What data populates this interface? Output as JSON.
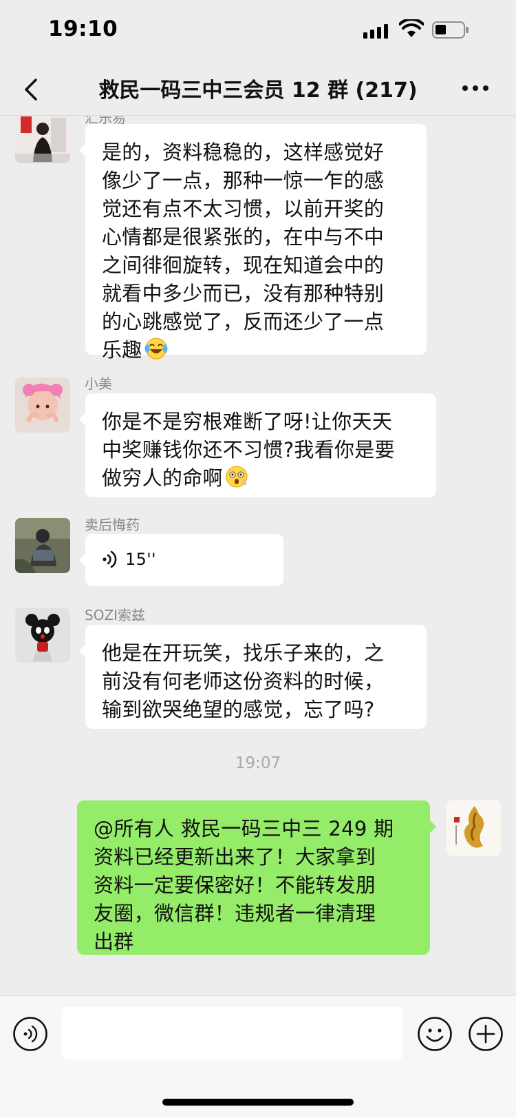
{
  "status_bar": {
    "time": "19:10"
  },
  "nav": {
    "title": "救民一码三中三会员 12 群 (217)"
  },
  "messages": [
    {
      "sender": "汇乐易",
      "lines": [
        "是的，资料稳稳的，这样感觉好",
        "像少了一点，那种一惊一乍的感",
        "觉还有点不太习惯，以前开奖的",
        "心情都是很紧张的，在中与不中",
        "之间徘徊旋转，现在知道会中的",
        "就看中多少而已，没有那种特别",
        "的心跳感觉了，反而还少了一点",
        "乐趣"
      ],
      "emoji": "laughing-tears"
    },
    {
      "sender": "小美",
      "lines": [
        "你是不是穷根难断了呀!让你天天",
        "中奖赚钱你还不习惯?我看你是要",
        "做穷人的命啊"
      ],
      "emoji": "flushed-face"
    },
    {
      "sender": "卖后悔药",
      "voice_duration": "15''"
    },
    {
      "sender": "SOZI索兹",
      "lines": [
        "他是在开玩笑，找乐子来的，之",
        "前没有何老师这份资料的时候，",
        "输到欲哭绝望的感觉，忘了吗?"
      ]
    }
  ],
  "time_divider": "19:07",
  "own_message": {
    "lines": [
      "@所有人  救民一码三中三 249 期",
      "资料已经更新出来了！大家拿到",
      "资料一定要保密好！不能转发朋",
      "友圈，微信群！违规者一律清理",
      "出群"
    ]
  },
  "colors": {
    "background": "#ededed",
    "own_bubble": "#95ec69",
    "other_bubble": "#ffffff",
    "meta_text": "#888888"
  }
}
